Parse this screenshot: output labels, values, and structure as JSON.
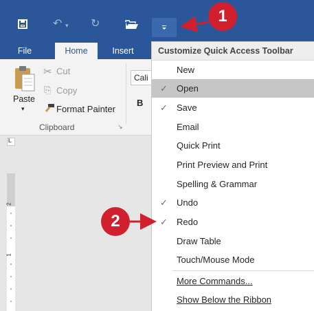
{
  "qat": {
    "save_icon": "save-icon",
    "undo_icon": "undo-icon",
    "redo_icon": "redo-icon",
    "open_icon": "open-folder-icon",
    "customize_icon": "customize-dropdown-icon"
  },
  "tabs": [
    {
      "label": "File"
    },
    {
      "label": "Home"
    },
    {
      "label": "Insert"
    }
  ],
  "clipboard": {
    "paste": "Paste",
    "cut": "Cut",
    "copy": "Copy",
    "format_painter": "Format Painter",
    "group_label": "Clipboard"
  },
  "font": {
    "name": "Cali",
    "bold": "B"
  },
  "menu": {
    "header": "Customize Quick Access Toolbar",
    "items": [
      {
        "label": "New",
        "checked": false
      },
      {
        "label": "Open",
        "checked": true
      },
      {
        "label": "Save",
        "checked": true
      },
      {
        "label": "Email",
        "checked": false
      },
      {
        "label": "Quick Print",
        "checked": false
      },
      {
        "label": "Print Preview and Print",
        "checked": false
      },
      {
        "label": "Spelling & Grammar",
        "checked": false
      },
      {
        "label": "Undo",
        "checked": true
      },
      {
        "label": "Redo",
        "checked": true
      },
      {
        "label": "Draw Table",
        "checked": false
      },
      {
        "label": "Touch/Mouse Mode",
        "checked": false
      },
      {
        "label": "More Commands...",
        "checked": false
      },
      {
        "label": "Show Below the Ribbon",
        "checked": false
      }
    ]
  },
  "ruler": {
    "tab_marker": "L",
    "numbers": [
      "2",
      "1"
    ]
  },
  "callouts": [
    {
      "label": "1"
    },
    {
      "label": "2"
    }
  ],
  "colors": {
    "accent": "#2b579a",
    "callout": "#d0202e",
    "highlight": "#c6c6c6"
  }
}
